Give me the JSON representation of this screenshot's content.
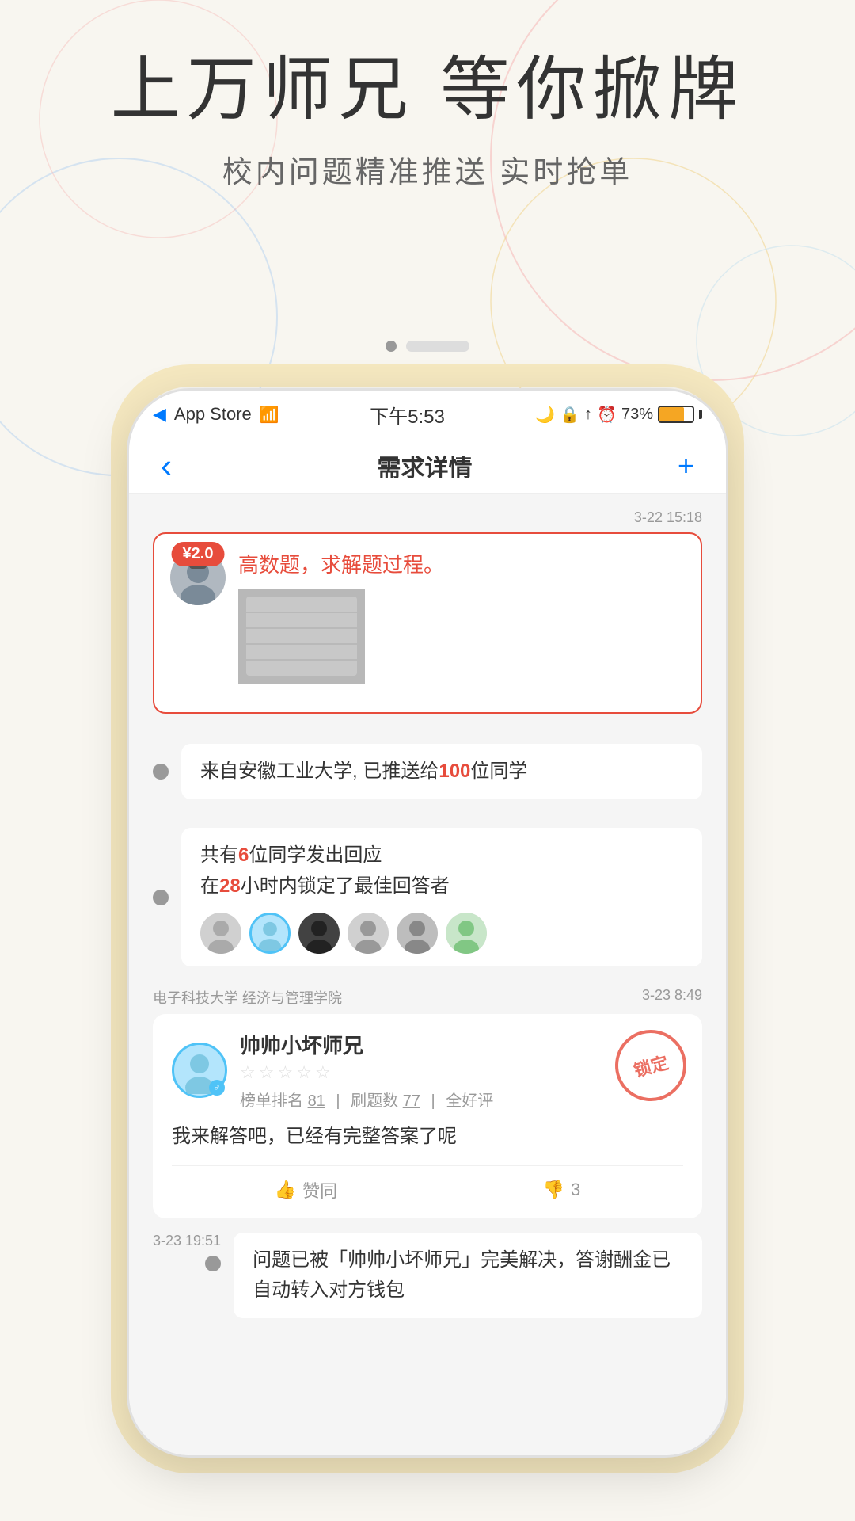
{
  "hero": {
    "title": "上万师兄 等你掀牌",
    "subtitle": "校内问题精准推送  实时抢单"
  },
  "pagination": {
    "dots": [
      {
        "active": true
      },
      {
        "active": false
      }
    ]
  },
  "status_bar": {
    "app_store": "App Store",
    "wifi": "WiFi",
    "time": "下午5:53",
    "battery_percent": "73%"
  },
  "nav": {
    "title": "需求详情",
    "back_label": "‹",
    "plus_label": "+"
  },
  "question": {
    "timestamp": "3-22 15:18",
    "price": "¥2.0",
    "text": "高数题，求解题过程。",
    "from_info": "来自安徽工业大学, 已推送给",
    "from_count": "100",
    "from_suffix": "位同学"
  },
  "responses": {
    "count_prefix": "共有",
    "count": "6",
    "count_suffix": "位同学发出回应",
    "lock_prefix": "在",
    "lock_hours": "28",
    "lock_suffix": "小时内锁定了最佳回答者"
  },
  "answer": {
    "meta_school": "电子科技大学  经济与管理学院",
    "meta_timestamp": "3-23 8:49",
    "username": "帅帅小坏师兄",
    "rank_label": "榜单排名",
    "rank_value": "81",
    "drill_label": "刷题数",
    "drill_value": "77",
    "review_label": "全好评",
    "text": "我来解答吧，已经有完整答案了呢",
    "like_label": "赞同",
    "dislike_count": "3",
    "locked_label": "锁定",
    "stars": [
      false,
      false,
      false,
      false,
      false
    ]
  },
  "final": {
    "timestamp": "3-23 19:51",
    "text": "问题已被「帅帅小坏师兄」完美解决，答谢酬金已自动转入对方钱包"
  },
  "icons": {
    "back": "‹",
    "plus": "+",
    "like": "👍",
    "dislike": "👎",
    "male": "♂"
  }
}
